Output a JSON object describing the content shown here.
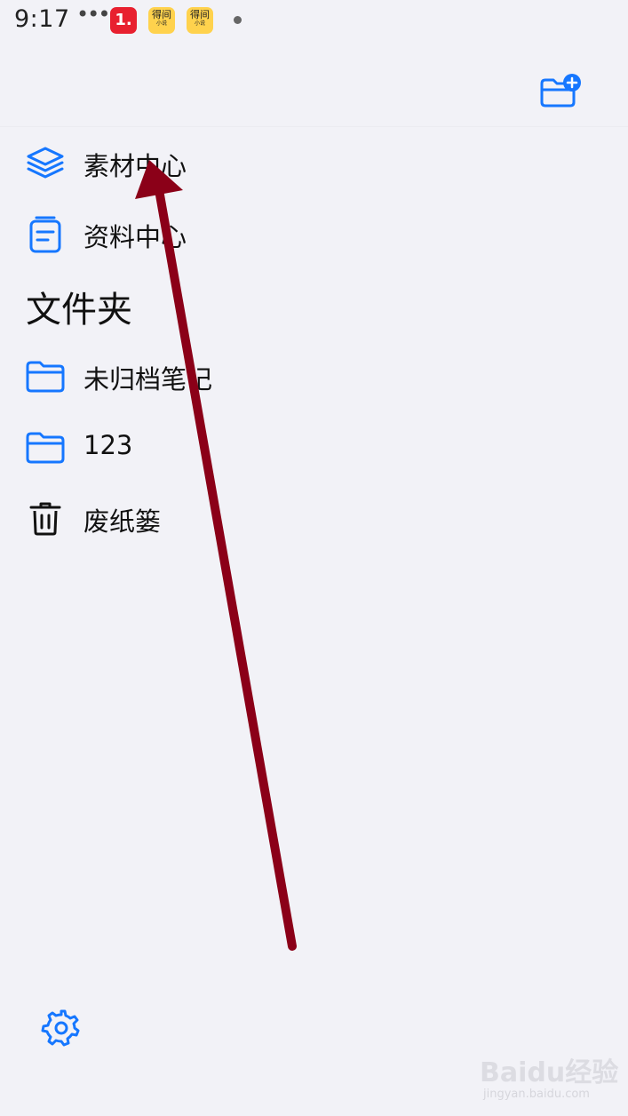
{
  "status_bar": {
    "time": "9:17",
    "overflow": "•••",
    "app_badge_1": "1.",
    "app_badge_2": "得间",
    "app_badge_2_sub": "小说",
    "app_badge_3": "得间",
    "app_badge_3_sub": "小说"
  },
  "header": {
    "new_folder_icon": "folder-plus-icon"
  },
  "menu": {
    "materials": {
      "label": "素材中心",
      "icon": "layers-icon"
    },
    "docs": {
      "label": "资料中心",
      "icon": "document-icon"
    }
  },
  "folders": {
    "title": "文件夹",
    "items": [
      {
        "label": "未归档笔记",
        "icon": "folder-icon"
      },
      {
        "label": "123",
        "icon": "folder-icon"
      },
      {
        "label": "废纸篓",
        "icon": "trash-icon"
      }
    ]
  },
  "footer": {
    "settings_icon": "gear-icon"
  },
  "watermark": {
    "logo": "Baidu经验",
    "url": "jingyan.baidu.com"
  },
  "colors": {
    "accent": "#1677ff",
    "background": "#f2f2f7",
    "annotation_arrow": "#8b0018"
  }
}
